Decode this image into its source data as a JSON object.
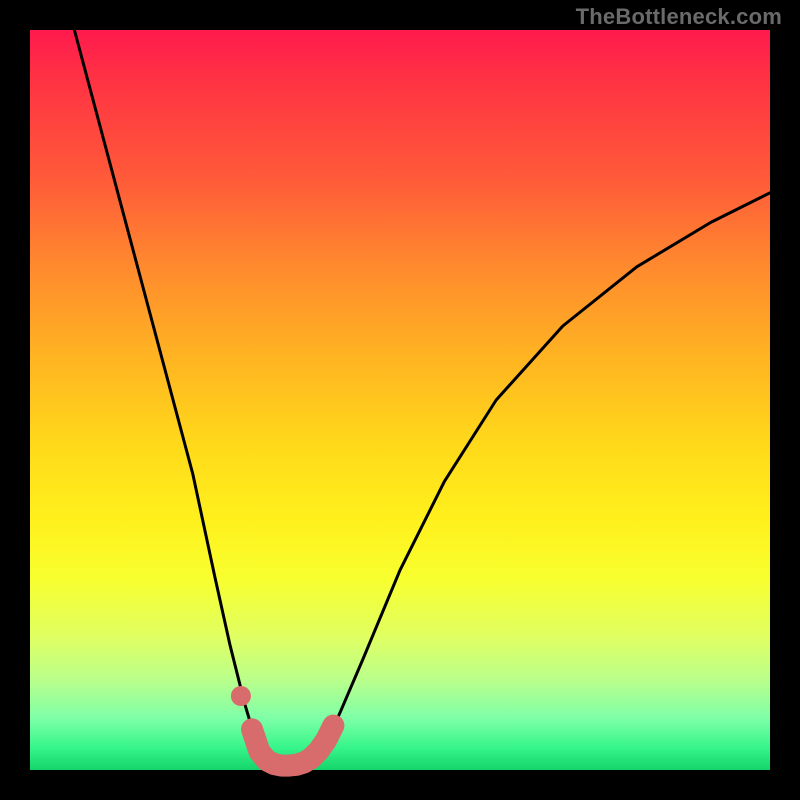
{
  "watermark": "TheBottleneck.com",
  "chart_data": {
    "type": "line",
    "title": "",
    "xlabel": "",
    "ylabel": "",
    "xlim": [
      0,
      100
    ],
    "ylim": [
      0,
      100
    ],
    "series": [
      {
        "name": "curve",
        "x": [
          6,
          10,
          14,
          18,
          22,
          25,
          27,
          29,
          30.5,
          32,
          33,
          34,
          35,
          36,
          37,
          38,
          39,
          40,
          42,
          45,
          50,
          56,
          63,
          72,
          82,
          92,
          100
        ],
        "values": [
          100,
          85,
          70,
          55,
          40,
          26,
          17,
          9,
          4,
          1.2,
          0.5,
          0.3,
          0.2,
          0.3,
          0.5,
          1.0,
          2.0,
          3.5,
          8,
          15,
          27,
          39,
          50,
          60,
          68,
          74,
          78
        ]
      },
      {
        "name": "emphasis-band",
        "x": [
          30,
          31,
          32,
          33,
          34,
          35,
          36,
          37,
          38,
          39,
          40,
          41
        ],
        "values": [
          5.5,
          2.5,
          1.3,
          0.8,
          0.6,
          0.6,
          0.7,
          1.0,
          1.6,
          2.6,
          4.0,
          6.0
        ]
      }
    ],
    "annotations": [
      {
        "type": "dot",
        "x": 28.5,
        "y": 10,
        "color": "#d86b6b"
      }
    ]
  },
  "colors": {
    "curve": "#000000",
    "emphasis": "#d86b6b",
    "frame": "#000000"
  }
}
